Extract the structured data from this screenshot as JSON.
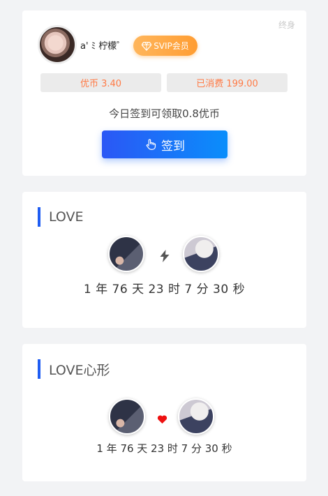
{
  "profile": {
    "duration_tag": "终身",
    "username": "a' ﾐ 柠檬゜",
    "vip_label": "SVIP会员",
    "coins_label": "优币 3.40",
    "spent_label": "已消费 199.00"
  },
  "checkin": {
    "tip": "今日签到可领取0.8优币",
    "button_label": "签到"
  },
  "love": {
    "title": "LOVE",
    "timer": "1 年 76 天 23 时 7 分 30 秒"
  },
  "love_heart": {
    "title": "LOVE心形",
    "timer": "1 年 76 天 23 时 7 分 30 秒"
  },
  "colors": {
    "accent": "#1f5df2",
    "vip": "#ffa940",
    "stat_text": "#ff7a45",
    "heart": "#ee1111"
  }
}
